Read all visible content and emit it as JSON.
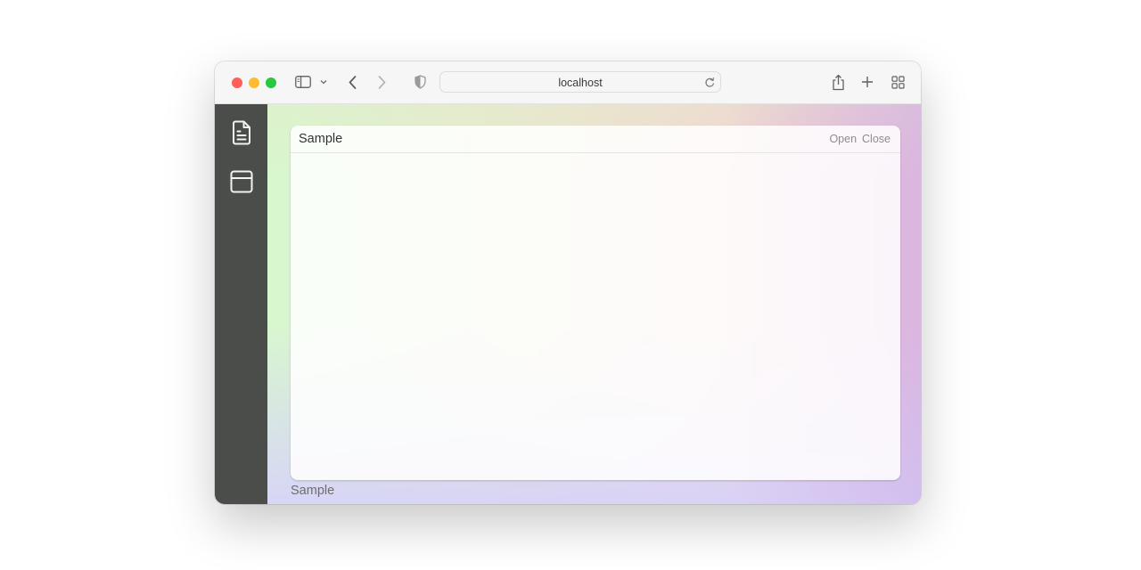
{
  "browser": {
    "address": "localhost"
  },
  "colors": {
    "close": "#ff5f57",
    "minimize": "#febc2e",
    "zoom": "#28c840",
    "sidebar": "#4b4d4b"
  },
  "icons": {
    "sidebar": [
      "document-icon",
      "window-panel-icon"
    ]
  },
  "panel": {
    "title": "Sample",
    "open_label": "Open",
    "close_label": "Close"
  },
  "footer": {
    "label": "Sample"
  }
}
